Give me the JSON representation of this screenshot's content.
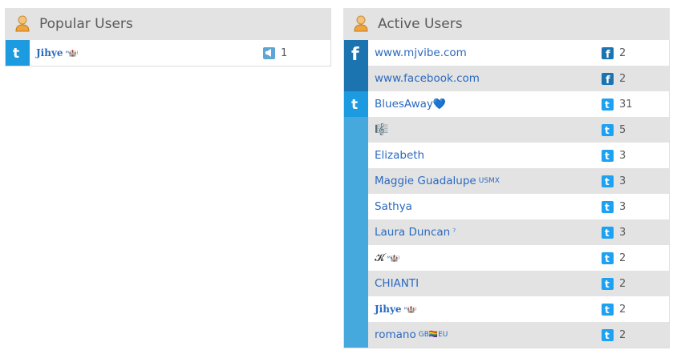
{
  "popular": {
    "title": "Popular Users",
    "rows": [
      {
        "name": "Jihye",
        "suffix": "ᴹ🏰ᴶ",
        "count": "1"
      }
    ]
  },
  "active": {
    "title": "Active Users",
    "facebook_rows": [
      {
        "name": "www.mjvibe.com",
        "count": "2"
      },
      {
        "name": "www.facebook.com",
        "count": "2"
      }
    ],
    "twitter_rows": [
      {
        "name": "BluesAway",
        "emoji": "💙",
        "count": "31"
      },
      {
        "name": "",
        "emoji": "🎼",
        "count": "5"
      },
      {
        "name": "Elizabeth",
        "count": "3"
      },
      {
        "name": "Maggie Guadalupe",
        "suffix": "USMX",
        "count": "3"
      },
      {
        "name": "Sathya",
        "count": "3"
      },
      {
        "name": "Laura Duncan",
        "suffix": "⁷",
        "count": "3"
      },
      {
        "name": "𝓚",
        "suffix": "ᴹ🏰ᴶ",
        "count": "2"
      },
      {
        "name": "CHIANTI",
        "count": "2"
      },
      {
        "name": "Jihye",
        "suffix": "ᴹ🏰ᴶ",
        "count": "2"
      },
      {
        "name": "romano",
        "suffix": "GB🏳️‍🌈EU",
        "count": "2"
      }
    ]
  },
  "colors": {
    "twitter": "#1da1f2",
    "twitter_col": "#45a9dd",
    "facebook": "#1b73b0",
    "link": "#2a6ac0"
  }
}
